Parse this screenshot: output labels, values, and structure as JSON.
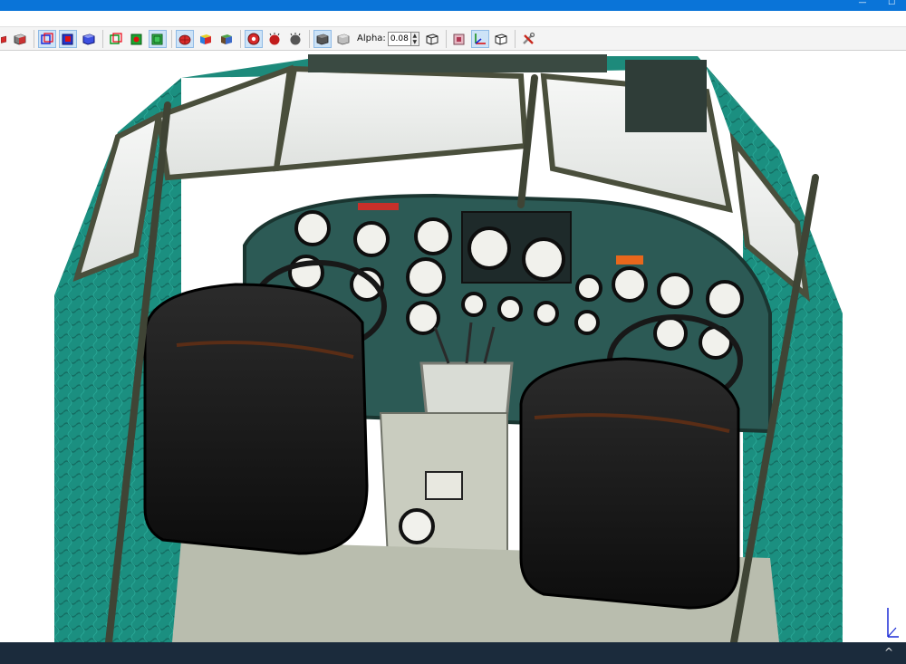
{
  "window": {
    "minimize_glyph": "—",
    "maximize_glyph": "☐"
  },
  "toolbar": {
    "alpha_label": "Alpha:",
    "alpha_value": "0.08",
    "icons": [
      "red-cube-icon",
      "shaded-cube-icon",
      "blue-wire-cube-icon",
      "blue-solid-cube-icon",
      "blue-outline-cube-icon",
      "green-wire-cube-icon",
      "green-solid-cube-icon",
      "green-outline-cube-icon",
      "red-mesh-icon",
      "colored-cube-icon",
      "textured-cube-icon",
      "red-sphere-icon",
      "red-ball-icon",
      "gray-ball-icon",
      "solid-box-icon",
      "transparent-box-icon",
      "wire-box-icon",
      "pink-box-icon",
      "axes-icon",
      "outline-box-icon",
      "tools-icon"
    ]
  },
  "viewport": {
    "scene_label": "3D cockpit model",
    "colors": {
      "fabric": "#1b8f80",
      "panel": "#2c5a55",
      "frame": "#4a4f3c",
      "seat": "#141414",
      "window": "#eef0ee",
      "floor": "#c9ccbf"
    }
  },
  "taskbar": {
    "chevron": "^"
  }
}
